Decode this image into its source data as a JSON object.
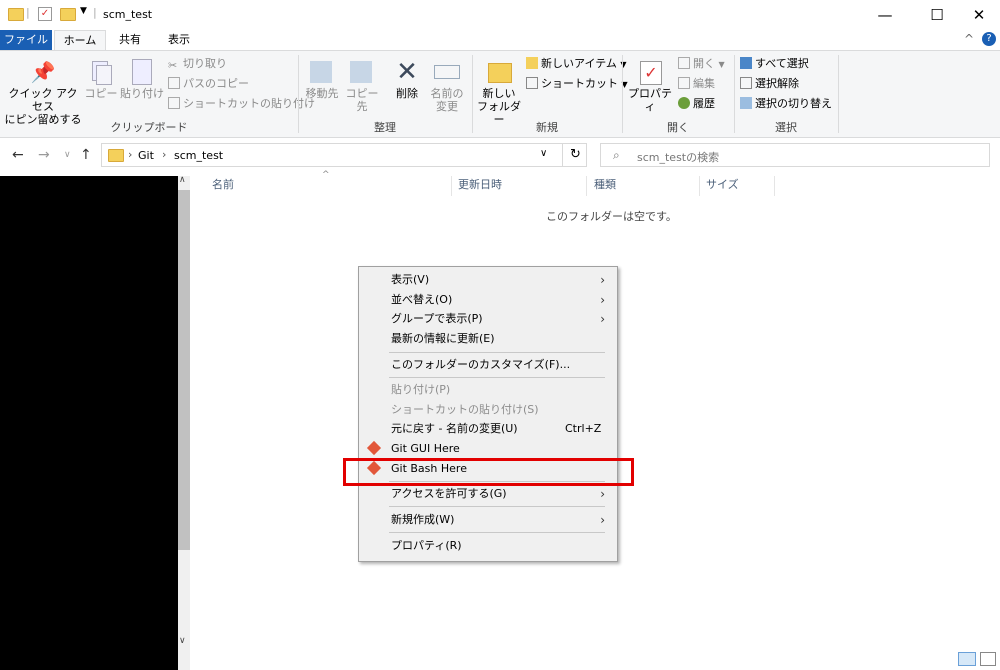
{
  "window": {
    "title": "scm_test",
    "minimize": "—",
    "maximize": "☐",
    "close": "✕"
  },
  "tabs": [
    {
      "label": "ファイル",
      "active": false,
      "highlight": true
    },
    {
      "label": "ホーム",
      "active": true
    },
    {
      "label": "共有"
    },
    {
      "label": "表示"
    }
  ],
  "ribbon": {
    "clipboard": {
      "label": "クリップボード",
      "pin": "クイック アクセス\nにピン留めする",
      "copy": "コピー",
      "paste": "貼り付け",
      "cut": "切り取り",
      "copy_path": "パスのコピー",
      "paste_shortcut": "ショートカットの貼り付け"
    },
    "organize": {
      "label": "整理",
      "move": "移動先",
      "copy_to": "コピー先",
      "delete": "削除",
      "rename": "名前の\n変更"
    },
    "new": {
      "label": "新規",
      "new_folder": "新しい\nフォルダー",
      "new_item": "新しいアイテム",
      "shortcut": "ショートカット"
    },
    "open": {
      "label": "開く",
      "properties": "プロパティ",
      "open": "開く",
      "edit": "編集",
      "history": "履歴"
    },
    "select": {
      "label": "選択",
      "select_all": "すべて選択",
      "select_none": "選択解除",
      "invert": "選択の切り替え"
    }
  },
  "address": {
    "path": [
      "Git",
      "scm_test"
    ],
    "search_placeholder": "scm_testの検索"
  },
  "columns": [
    "名前",
    "更新日時",
    "種類",
    "サイズ"
  ],
  "empty_message": "このフォルダーは空です。",
  "context_menu": {
    "items": [
      {
        "label": "表示(V)",
        "submenu": true
      },
      {
        "label": "並べ替え(O)",
        "submenu": true
      },
      {
        "label": "グループで表示(P)",
        "submenu": true
      },
      {
        "label": "最新の情報に更新(E)"
      },
      {
        "sep": true
      },
      {
        "label": "このフォルダーのカスタマイズ(F)..."
      },
      {
        "sep": true
      },
      {
        "label": "貼り付け(P)",
        "disabled": true
      },
      {
        "label": "ショートカットの貼り付け(S)",
        "disabled": true
      },
      {
        "label": "元に戻す - 名前の変更(U)",
        "shortcut": "Ctrl+Z"
      },
      {
        "label": "Git GUI Here",
        "icon": "git-icon"
      },
      {
        "label": "Git Bash Here",
        "icon": "git-icon"
      },
      {
        "sep": true
      },
      {
        "label": "アクセスを許可する(G)",
        "submenu": true
      },
      {
        "sep": true
      },
      {
        "label": "新規作成(W)",
        "submenu": true
      },
      {
        "sep": true
      },
      {
        "label": "プロパティ(R)"
      }
    ]
  },
  "colors": {
    "file_tab": "#1a5fb4",
    "highlight_box": "#e20000",
    "ribbon_bg": "#f5f6f7"
  }
}
